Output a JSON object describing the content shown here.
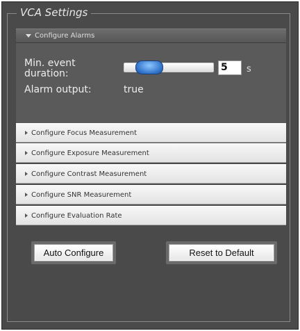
{
  "fieldset": {
    "legend": "VCA Settings"
  },
  "alarms": {
    "header": "Configure Alarms",
    "min_event_label_line1": "Min. event",
    "min_event_label_line2": "duration:",
    "min_event_value": "5",
    "min_event_unit": "s",
    "slider_level_fraction": 0.3,
    "alarm_output_label": "Alarm output:",
    "alarm_output_value": "true"
  },
  "sections": [
    {
      "label": "Configure Focus Measurement"
    },
    {
      "label": "Configure Exposure Measurement"
    },
    {
      "label": "Configure Contrast Measurement"
    },
    {
      "label": "Configure SNR Measurement"
    },
    {
      "label": "Configure Evaluation Rate"
    }
  ],
  "buttons": {
    "auto_configure": "Auto Configure",
    "reset_default": "Reset to Default"
  },
  "colors": {
    "panel_bg": "#4a4a4a",
    "slider_handle": "#2f72c9"
  }
}
